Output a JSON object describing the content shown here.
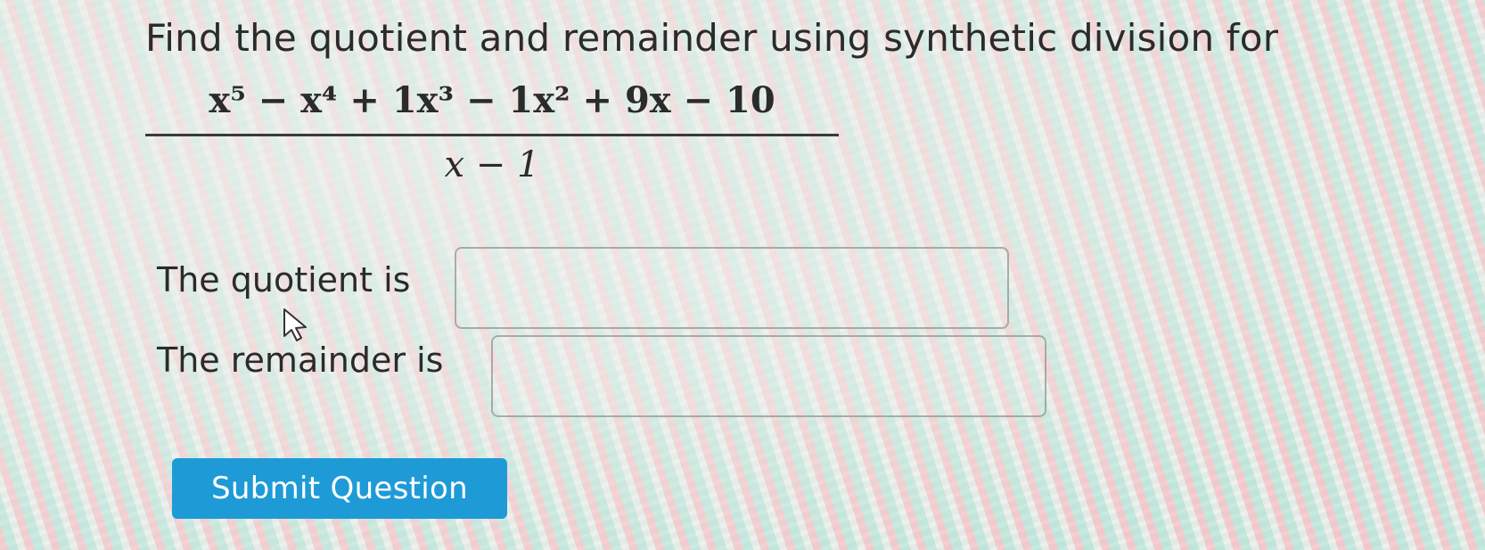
{
  "question": {
    "prompt": "Find the quotient and remainder using synthetic division for",
    "numerator": "x⁵ − x⁴ + 1x³ − 1x² + 9x − 10",
    "denominator": "x − 1"
  },
  "form": {
    "quotient_label": "The quotient is",
    "quotient_value": "",
    "remainder_label": "The remainder is",
    "remainder_value": ""
  },
  "submit": {
    "label": "Submit Question"
  },
  "colors": {
    "button_background": "#1e9bd7",
    "button_text": "#ffffff"
  },
  "icons": {
    "cursor": "mouse-pointer-icon"
  }
}
